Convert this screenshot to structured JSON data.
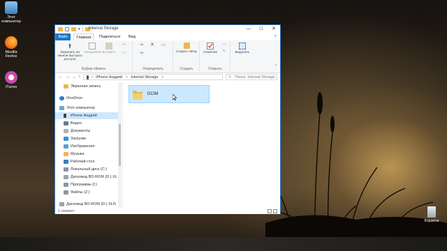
{
  "desktop": {
    "icons": [
      {
        "label": "Этот компьютер"
      },
      {
        "label": "Mozilla Firefox"
      },
      {
        "label": "iTunes"
      }
    ],
    "recycle_bin_label": "Корзина"
  },
  "window": {
    "title": "Internal Storage",
    "controls": {
      "minimize": "—",
      "maximize": "☐",
      "close": "✕"
    },
    "tabs": [
      {
        "label": "Файл"
      },
      {
        "label": "Главная"
      },
      {
        "label": "Поделиться"
      },
      {
        "label": "Вид"
      }
    ],
    "ribbon": {
      "clipboard": {
        "pin_label": "Закрепить на панели быстрого доступа",
        "copy_label": "Копировать",
        "paste_label": "Вставить",
        "group_label": "Буфер обмена"
      },
      "organize": {
        "group_label": "Упорядочить"
      },
      "new": {
        "new_folder_label": "Создать папку",
        "group_label": "Создать"
      },
      "open": {
        "properties_label": "Свойства",
        "group_label": "Открыть"
      },
      "select": {
        "select_label": "Выделить"
      }
    },
    "address": {
      "segments": [
        "iPhone Андрей",
        "Internal Storage"
      ],
      "separator": ">",
      "search_placeholder": "Поиск: Internal Storage"
    },
    "nav_items": [
      {
        "label": "Экранная запись"
      },
      {
        "label": "OneDrive"
      },
      {
        "label": "Этот компьютер"
      },
      {
        "label": "iPhone Андрей"
      },
      {
        "label": "Видео"
      },
      {
        "label": "Документы"
      },
      {
        "label": "Загрузки"
      },
      {
        "label": "Изображения"
      },
      {
        "label": "Музыка"
      },
      {
        "label": "Рабочий стол"
      },
      {
        "label": "Локальный диск (C:)"
      },
      {
        "label": "Дисковод BD-ROM (D:) XL"
      },
      {
        "label": "Программы (I:)"
      },
      {
        "label": "Файлы (Z:)"
      },
      {
        "label": "Дисковод BD-ROM (D:) XLN"
      }
    ],
    "files": [
      {
        "name": "DCIM",
        "type": "folder"
      }
    ],
    "status_text": "1 элемент"
  },
  "colors": {
    "accent": "#1979ca",
    "selection": "#cce8ff",
    "folder": "#e8b84a"
  }
}
